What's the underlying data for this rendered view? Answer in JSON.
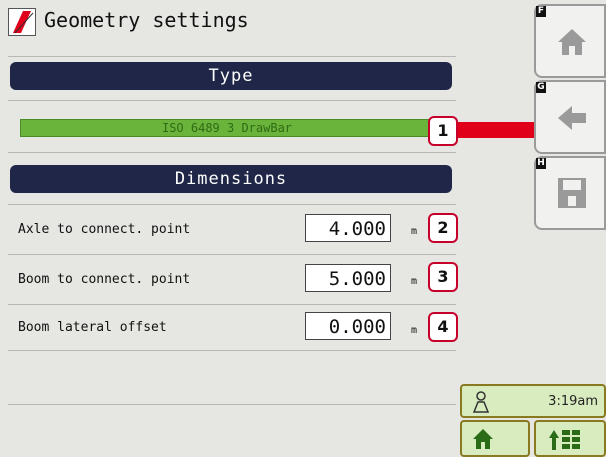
{
  "header": {
    "title": "Geometry settings"
  },
  "sections": {
    "type": {
      "title": "Type",
      "selected": "ISO 6489 3 DrawBar"
    },
    "dimensions": {
      "title": "Dimensions"
    }
  },
  "rows": [
    {
      "label": "Axle to connect. point",
      "value": "4.000",
      "unit": "m",
      "callout": "2"
    },
    {
      "label": "Boom to connect. point",
      "value": "5.000",
      "unit": "m",
      "callout": "3"
    },
    {
      "label": "Boom lateral offset",
      "value": "0.000",
      "unit": "m",
      "callout": "4"
    }
  ],
  "callouts": {
    "type_callout": "1"
  },
  "softkeys": [
    {
      "letter": "F",
      "icon": "home-icon"
    },
    {
      "letter": "G",
      "icon": "back-arrow-icon"
    },
    {
      "letter": "H",
      "icon": "save-disk-icon"
    }
  ],
  "status": {
    "time": "3:19am",
    "icon": "operator-icon"
  },
  "bottom_buttons": [
    {
      "icon": "home-icon"
    },
    {
      "icon": "boom-section-icon"
    }
  ],
  "colors": {
    "header_bg": "#1f2647",
    "type_bar": "#6ab43c",
    "callout_border": "#c6002a",
    "arrow": "#e0001a",
    "status_bg": "#d8ecc0"
  }
}
